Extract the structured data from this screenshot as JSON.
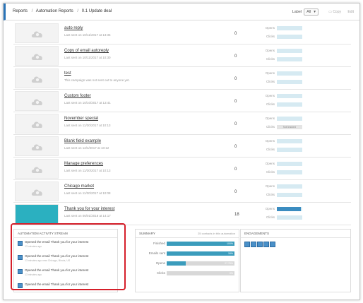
{
  "breadcrumb": [
    "Reports",
    "Automation Reports",
    "0.1 Update deal"
  ],
  "header": {
    "label_caption": "Label",
    "label_value": "All",
    "copy_label": "Copy",
    "edit_label": "Edit"
  },
  "stat_labels": {
    "opens": "Opens",
    "clicks": "Clicks"
  },
  "campaigns": [
    {
      "name": "auto reply",
      "sent": "Last sent on 10/11/2017 at 13:35",
      "count": "0",
      "opens_pct": 0,
      "clicks_pct": 0,
      "clicks_text": ""
    },
    {
      "name": "Copy of email autoreply",
      "sent": "Last sent on 10/11/2017 at 10:30",
      "count": "0",
      "opens_pct": 0,
      "clicks_pct": 0,
      "clicks_text": ""
    },
    {
      "name": "test",
      "sent": "This campaign was not sent out to anyone yet.",
      "count": "0",
      "opens_pct": 0,
      "clicks_pct": 0,
      "clicks_text": ""
    },
    {
      "name": "Custom footer",
      "sent": "Last sent on 10/10/2017 at 13:41",
      "count": "0",
      "opens_pct": 0,
      "clicks_pct": 0,
      "clicks_text": ""
    },
    {
      "name": "November special",
      "sent": "Last sent on 11/30/2017 at 10:13",
      "count": "0",
      "opens_pct": 0,
      "clicks_pct": 0,
      "clicks_text": "Not tracked"
    },
    {
      "name": "Blank field example",
      "sent": "Last sent on 12/4/2017 at 10:12",
      "count": "0",
      "opens_pct": 0,
      "clicks_pct": 0,
      "clicks_text": ""
    },
    {
      "name": "Manage preferences",
      "sent": "Last sent on 11/30/2017 at 10:13",
      "count": "0",
      "opens_pct": 0,
      "clicks_pct": 0,
      "clicks_text": ""
    },
    {
      "name": "Chicago market",
      "sent": "Last sent on 11/30/2017 at 10:08",
      "count": "0",
      "opens_pct": 0,
      "clicks_pct": 0,
      "clicks_text": ""
    },
    {
      "name": "Thank you for your interest",
      "sent": "Last sent on 06/01/2018 at 14:17",
      "count": "18",
      "opens_pct": 95,
      "clicks_pct": 0,
      "clicks_text": ""
    }
  ],
  "stream": {
    "title": "AUTOMATION ACTIVITY STREAM",
    "items": [
      {
        "text": "Opened the email Thank you for your interest",
        "sub": "13 minutes ago"
      },
      {
        "text": "Opened the email Thank you for your interest",
        "sub": "13 minutes ago near Chicago, Illinois, US"
      },
      {
        "text": "Opened the email Thank you for your interest",
        "sub": "13 minutes ago"
      },
      {
        "text": "Opened the email Thank you for your interest",
        "sub": ""
      }
    ]
  },
  "summary": {
    "title": "SUMMARY",
    "subtitle": "25 contacts in this automation",
    "rows": [
      {
        "label": "Finished",
        "pct": 100,
        "value": "100%"
      },
      {
        "label": "Emails sent",
        "pct": 100,
        "value": "18%"
      },
      {
        "label": "Opens",
        "pct": 27.78,
        "value": "27.78%"
      },
      {
        "label": "Clicks",
        "pct": 0,
        "value": "0%"
      }
    ]
  },
  "engagements": {
    "title": "ENGAGEMENTS",
    "avatar_count": 5
  },
  "colors": {
    "accent": "#3b8cc0",
    "highlight": "#d51f2a",
    "bar_bg": "#d6eaf2"
  }
}
